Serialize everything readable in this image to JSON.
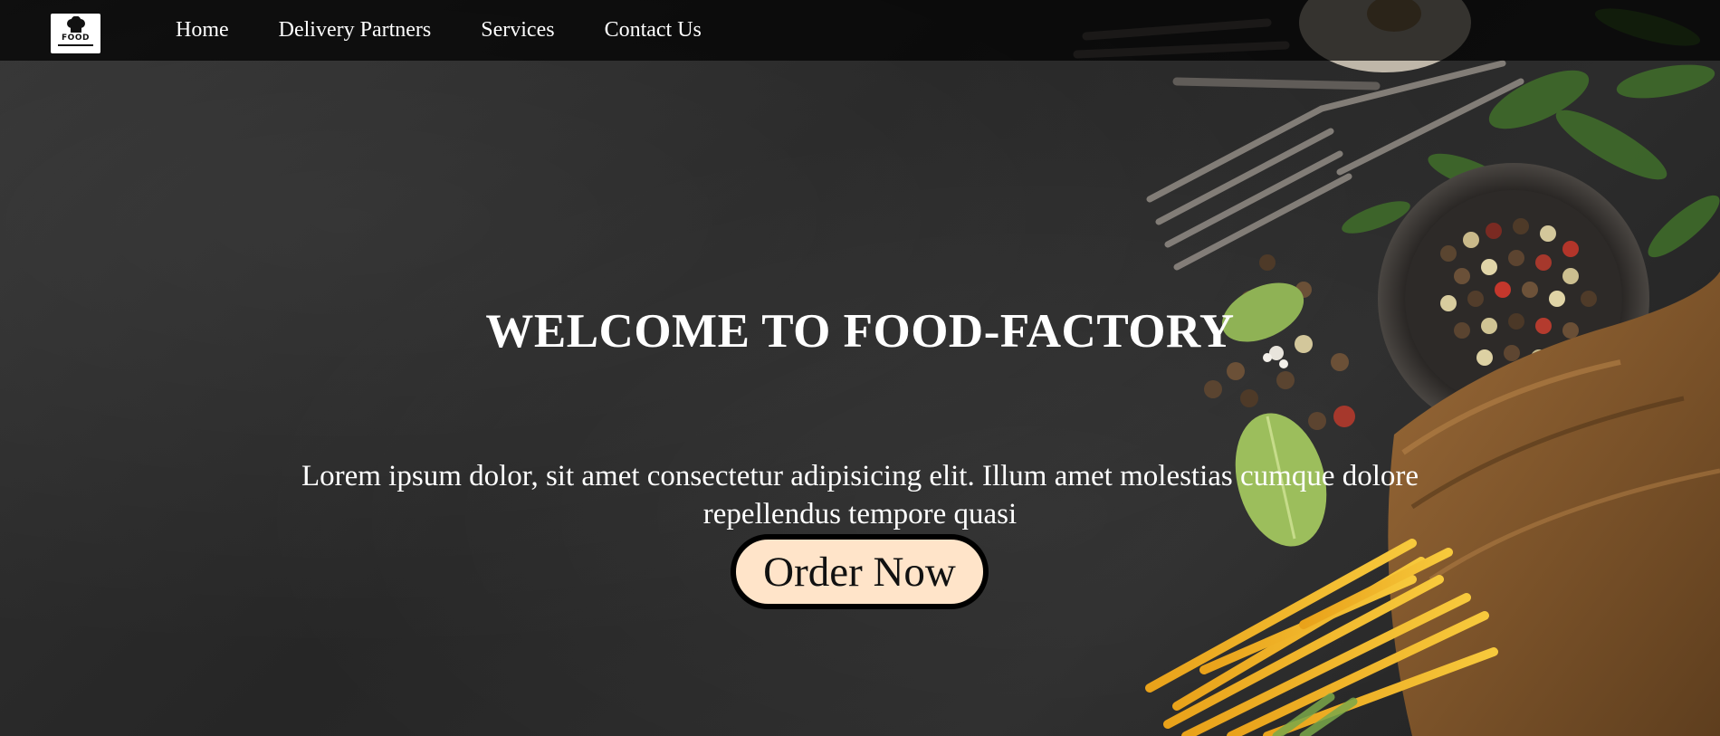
{
  "nav": {
    "logo_text": "FOOD",
    "items": [
      {
        "label": "Home"
      },
      {
        "label": "Delivery Partners"
      },
      {
        "label": "Services"
      },
      {
        "label": "Contact Us"
      }
    ]
  },
  "hero": {
    "title": "WELCOME TO FOOD-FACTORY",
    "description": "Lorem ipsum dolor, sit amet consectetur adipisicing elit. Illum amet molestias cumque dolore repellendus tempore quasi",
    "cta_label": "Order Now"
  },
  "colors": {
    "navbar_bg": "#000000",
    "hero_text": "#ffffff",
    "button_bg": "#ffe4c9",
    "button_border": "#000000"
  }
}
